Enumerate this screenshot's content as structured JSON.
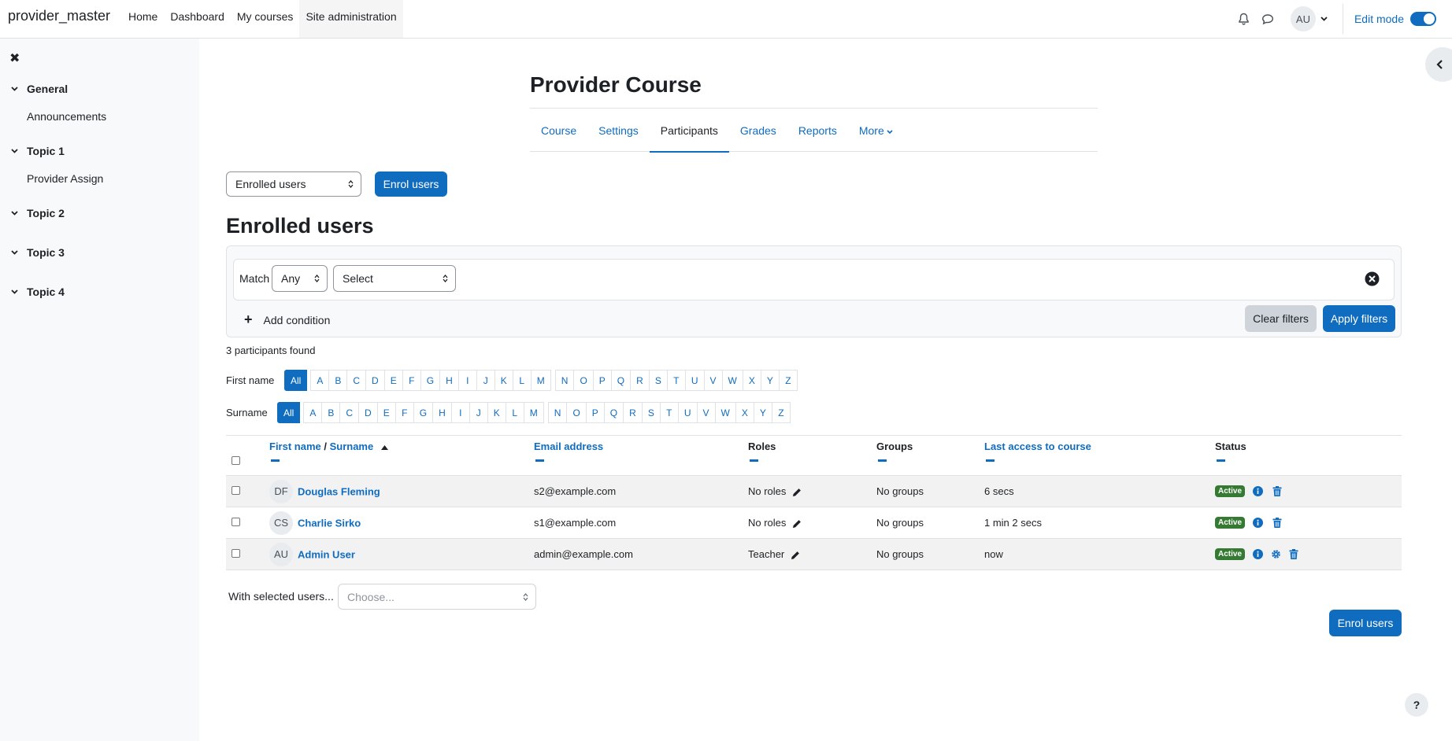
{
  "navbar": {
    "brand": "provider_master",
    "items": [
      "Home",
      "Dashboard",
      "My courses",
      "Site administration"
    ],
    "user_initials": "AU",
    "edit_mode_label": "Edit mode"
  },
  "drawer": {
    "sections": [
      {
        "title": "General",
        "items": [
          "Announcements"
        ]
      },
      {
        "title": "Topic 1",
        "items": [
          "Provider Assign"
        ]
      },
      {
        "title": "Topic 2",
        "items": []
      },
      {
        "title": "Topic 3",
        "items": []
      },
      {
        "title": "Topic 4",
        "items": []
      }
    ]
  },
  "course": {
    "title": "Provider Course",
    "tabs": [
      "Course",
      "Settings",
      "Participants",
      "Grades",
      "Reports",
      "More"
    ],
    "active_tab": "Participants"
  },
  "controls": {
    "view_select": "Enrolled users",
    "enrol_button": "Enrol users"
  },
  "heading": "Enrolled users",
  "filter": {
    "match_label": "Match",
    "match_value": "Any",
    "type_value": "Select",
    "add_condition": "Add condition",
    "clear_filters": "Clear filters",
    "apply_filters": "Apply filters"
  },
  "found_text": "3 participants found",
  "initials": {
    "firstname_label": "First name",
    "surname_label": "Surname",
    "all_label": "All",
    "letters_a_m": [
      "A",
      "B",
      "C",
      "D",
      "E",
      "F",
      "G",
      "H",
      "I",
      "J",
      "K",
      "L",
      "M"
    ],
    "letters_n_z": [
      "N",
      "O",
      "P",
      "Q",
      "R",
      "S",
      "T",
      "U",
      "V",
      "W",
      "X",
      "Y",
      "Z"
    ]
  },
  "table": {
    "headers": {
      "firstname": "First name",
      "slash": " / ",
      "surname": "Surname",
      "email": "Email address",
      "roles": "Roles",
      "groups": "Groups",
      "lastaccess": "Last access to course",
      "status": "Status"
    },
    "rows": [
      {
        "initials": "DF",
        "name": "Douglas Fleming",
        "email": "s2@example.com",
        "role": "No roles",
        "groups": "No groups",
        "last_access": "6 secs",
        "status": "Active"
      },
      {
        "initials": "CS",
        "name": "Charlie Sirko",
        "email": "s1@example.com",
        "role": "No roles",
        "groups": "No groups",
        "last_access": "1 min 2 secs",
        "status": "Active"
      },
      {
        "initials": "AU",
        "name": "Admin User",
        "email": "admin@example.com",
        "role": "Teacher",
        "groups": "No groups",
        "last_access": "now",
        "status": "Active"
      }
    ]
  },
  "bulk": {
    "label": "With selected users...",
    "placeholder": "Choose..."
  },
  "bottom_enrol": "Enrol users",
  "help": "?",
  "colors": {
    "primary": "#0f6cbf",
    "active_badge": "#357a32",
    "drawer_bg": "#f8f9fa"
  }
}
